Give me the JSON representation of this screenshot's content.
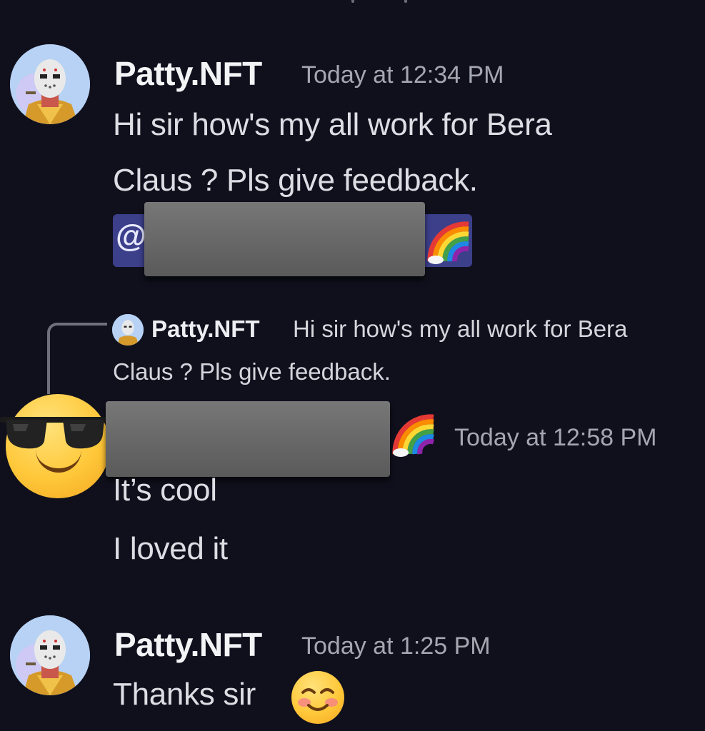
{
  "messages": [
    {
      "username": "Patty.NFT",
      "timestamp": "Today at 12:34 PM",
      "lines": [
        "Hi sir how's my all work for Bera",
        "Claus ? Pls give feedback."
      ],
      "mention_prefix": "@",
      "mention_emoji": "🌈"
    },
    {
      "reply": {
        "username": "Patty.NFT",
        "text_line1": "Hi sir how's my all work for Bera",
        "text_line2": "Claus ? Pls give feedback."
      },
      "author_emoji": "🌈",
      "timestamp": "Today at 12:58 PM",
      "lines": [
        "It’s cool",
        "I loved it"
      ]
    },
    {
      "username": "Patty.NFT",
      "timestamp": "Today at 1:25 PM",
      "text": "Thanks sir"
    }
  ],
  "colors": {
    "background": "#10101d",
    "mention_bg": "#3c3f8a",
    "timestamp": "#a4a7b0"
  },
  "icons": {
    "reply_connector": "reply-line-icon",
    "cool_avatar": "sunglasses-face-icon",
    "blush_emoji": "smiling-blush-face-icon",
    "rainbow": "rainbow-icon"
  }
}
